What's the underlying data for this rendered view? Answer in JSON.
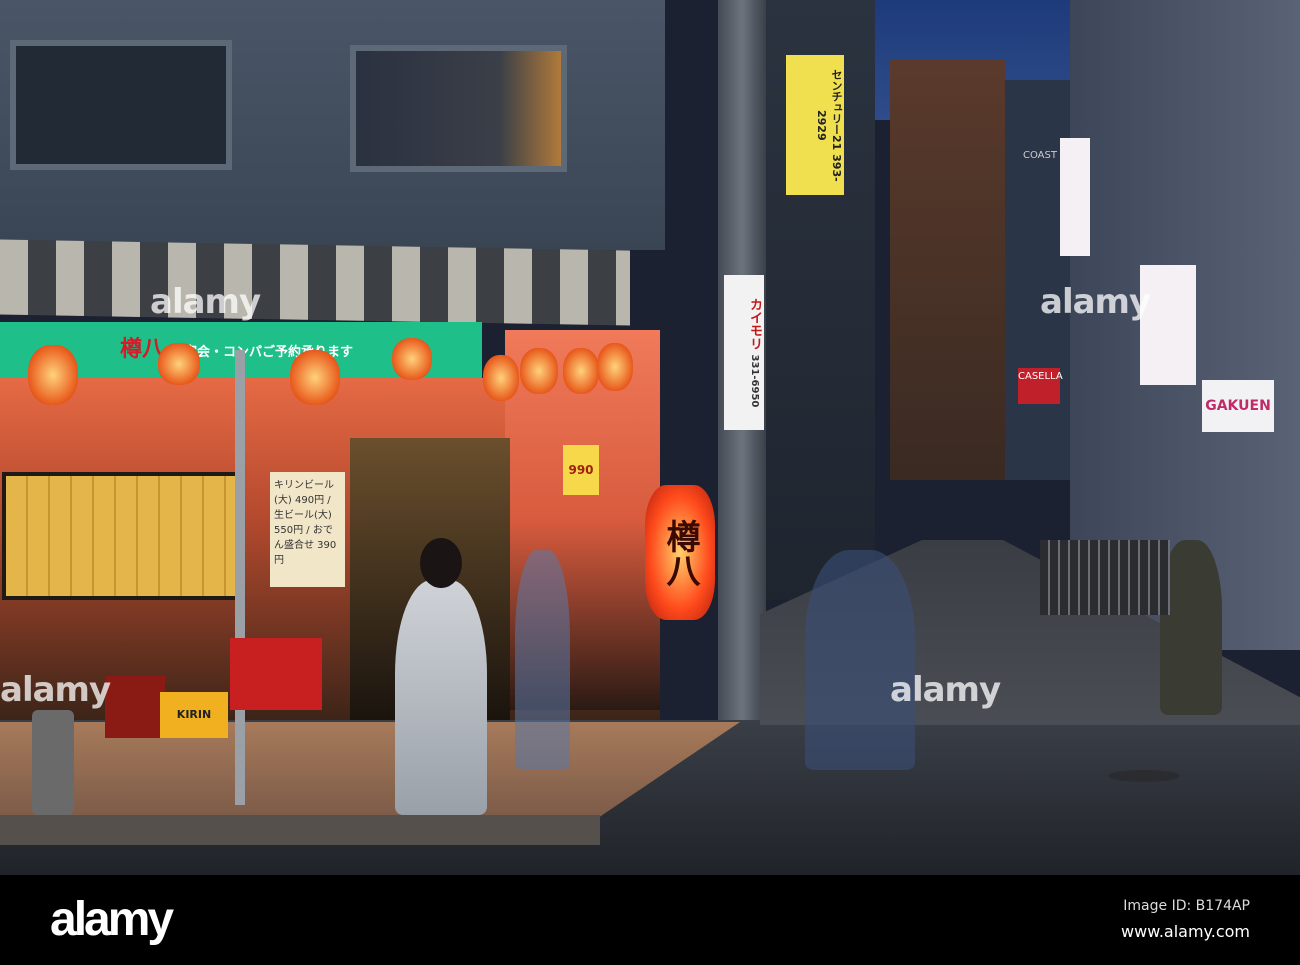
{
  "photo": {
    "description_free": true,
    "signs": {
      "green_sign": "樽八",
      "green_sign_sub": "宴会・コンパご予約承ります",
      "big_lantern": "樽八",
      "pole_sign": "カイモリ",
      "pole_phone": "331-6950",
      "coast": "COAST",
      "gakuen": "GAKUEN",
      "casella": "CASELLA",
      "price_tag": "990",
      "crate": "KIRIN",
      "menu": "キリンビール(大) 490円 / 生ビール(大) 550円 / おでん盛合せ 390円",
      "century21": "センチュリー21",
      "century_phone": "393-2929"
    }
  },
  "watermarks": [
    "alamy",
    "alamy",
    "alamy",
    "alamy"
  ],
  "footer": {
    "logo": "alamy",
    "image_id": "Image ID: B174AP",
    "url": "www.alamy.com"
  }
}
